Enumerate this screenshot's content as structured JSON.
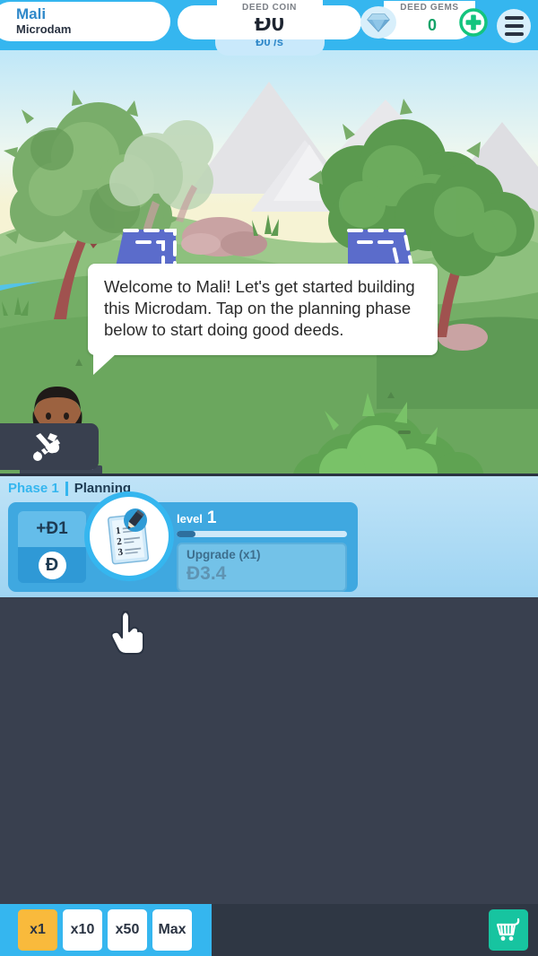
{
  "header": {
    "country": "Mali",
    "project": "Microdam",
    "coin_label": "DEED COIN",
    "coin_value": "Ð0",
    "coin_rate": "Ð0 /s",
    "gems_label": "DEED GEMS",
    "gems_value": "0",
    "gem_icon": "diamond-icon",
    "plus_icon": "plus-circle-icon",
    "menu_icon": "hamburger-menu-icon"
  },
  "scene": {
    "building_name": "microdam-blueprint",
    "advisor_icon": "advisor-avatar",
    "tools_icon": "hammer-wrench-icon",
    "tutorial_text": "Welcome to Mali! Let's get started building this Microdam. Tap on the planning phase below to start doing good deeds."
  },
  "phase": {
    "phase_number": "Phase 1",
    "phase_name": "Planning",
    "coin_gain": "+Ð1",
    "coin_icon": "deed-coin-icon",
    "card_icon": "clipboard-pencil-icon",
    "level_word": "level",
    "level_value": "1",
    "progress_percent": 11,
    "upgrade_label": "Upgrade (x1)",
    "upgrade_cost": "Ð3.4"
  },
  "cursor": {
    "icon": "pointing-hand-cursor"
  },
  "bottom": {
    "multipliers": [
      {
        "label": "x1",
        "active": true
      },
      {
        "label": "x10",
        "active": false
      },
      {
        "label": "x50",
        "active": false
      },
      {
        "label": "Max",
        "active": false
      }
    ],
    "shop_icon": "shopping-cart-icon"
  },
  "colors": {
    "sky_blue": "#35b6ef",
    "panel_dark": "#39404f",
    "accent_orange": "#f9ba3c",
    "shop_green": "#17c4a0",
    "gem_green": "#13a368",
    "blueprint_blue": "#5b6ccb"
  }
}
